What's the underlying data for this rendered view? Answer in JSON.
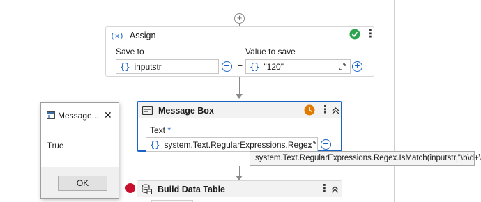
{
  "assign": {
    "title": "Assign",
    "icon": "x-variable-icon",
    "save_to_label": "Save to",
    "value_label": "Value to save",
    "save_to_value": "inputstr",
    "equals": "=",
    "value": "\"120\"",
    "status_icon": "check-circle-icon"
  },
  "message_box": {
    "title": "Message Box",
    "text_label": "Text",
    "required_mark": "*",
    "text_value": "system.Text.RegularExpressions.Regex.IsMa",
    "status_icon": "clock-warning-icon",
    "tooltip": "system.Text.RegularExpressions.Regex.IsMatch(inputstr,\"\\b\\d+\\b\")"
  },
  "build_data_table": {
    "title": "Build Data Table",
    "icon": "database-table-icon"
  },
  "dialog": {
    "title": "Message...",
    "body": "True",
    "ok_label": "OK",
    "close_glyph": "✕"
  },
  "colors": {
    "accent": "#1a64c8",
    "success": "#2ea44f",
    "warning": "#e07b00",
    "breakpoint": "#c8102e"
  }
}
